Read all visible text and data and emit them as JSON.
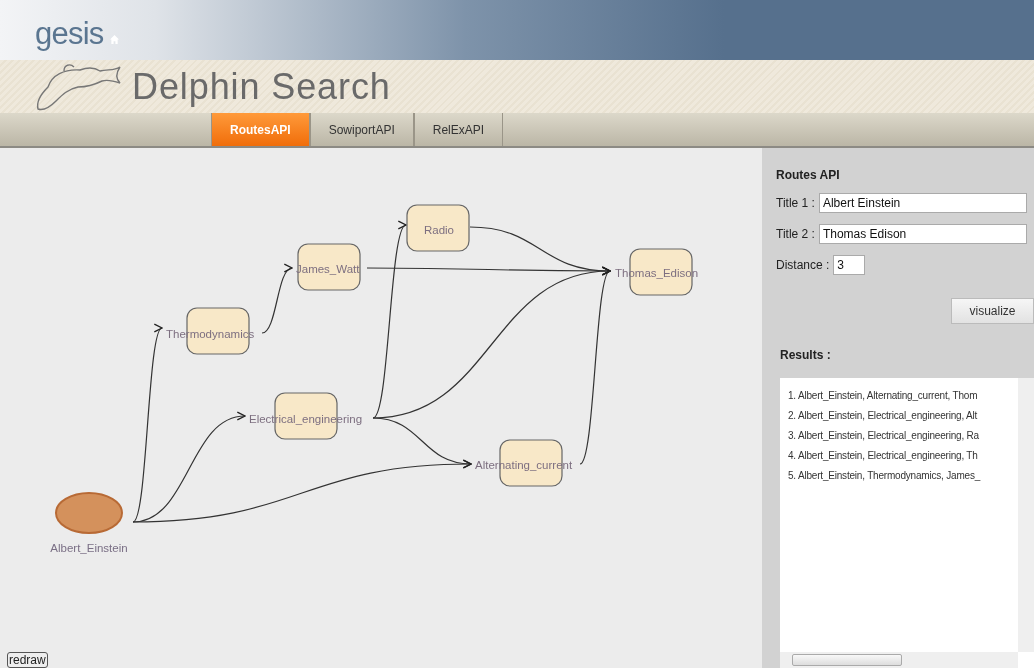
{
  "header": {
    "logo": "gesis"
  },
  "banner": {
    "title": "Delphin Search"
  },
  "tabs": [
    {
      "label": "RoutesAPI",
      "selected": true
    },
    {
      "label": "SowiportAPI",
      "selected": false
    },
    {
      "label": "RelExAPI",
      "selected": false
    }
  ],
  "graph": {
    "nodes": [
      {
        "label": "Albert_Einstein",
        "kind": "source"
      },
      {
        "label": "Thermodynamics",
        "kind": "box"
      },
      {
        "label": "James_Watt",
        "kind": "box"
      },
      {
        "label": "Electrical_engineering",
        "kind": "box"
      },
      {
        "label": "Radio",
        "kind": "box"
      },
      {
        "label": "Alternating_current",
        "kind": "box"
      },
      {
        "label": "Thomas_Edison",
        "kind": "box"
      }
    ],
    "redraw_button": "redraw"
  },
  "panel": {
    "title": "Routes API",
    "fields": [
      {
        "label": "Title 1 :",
        "value": "Albert Einstein",
        "kind": "wide"
      },
      {
        "label": "Title 2 :",
        "value": "Thomas Edison",
        "kind": "wide"
      },
      {
        "label": "Distance :",
        "value": "3",
        "kind": "short"
      }
    ],
    "visualize_button": "visualize",
    "results_title": "Results :",
    "results": [
      "1. Albert_Einstein, Alternating_current, Thom",
      "2. Albert_Einstein, Electrical_engineering, Alt",
      "3. Albert_Einstein, Electrical_engineering, Ra",
      "4. Albert_Einstein, Electrical_engineering, Th",
      "5. Albert_Einstein, Thermodynamics, James_"
    ]
  }
}
